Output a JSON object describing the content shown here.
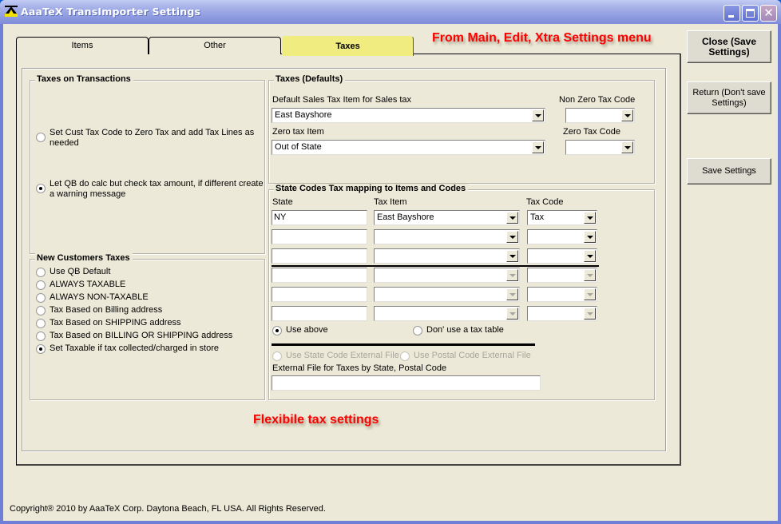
{
  "window": {
    "title": "AaaTeX TransImporter Settings",
    "controls": {
      "minimize": "_",
      "maximize": "□",
      "close": "✕"
    }
  },
  "tabs": [
    {
      "label": "Items",
      "active": false
    },
    {
      "label": "Other",
      "active": false
    },
    {
      "label": "Taxes",
      "active": true
    }
  ],
  "annotations": {
    "top": "From Main, Edit, Xtra Settings menu",
    "middle": "Flexibile tax settings"
  },
  "buttons": {
    "close_save": "Close (Save Settings)",
    "return_no_save": "Return (Don't save Settings)",
    "save_settings": "Save Settings"
  },
  "taxes_on_transactions": {
    "title": "Taxes on Transactions",
    "options": [
      {
        "label": "Set Cust Tax Code to Zero Tax and add Tax Lines as needed",
        "checked": false
      },
      {
        "label": "Let QB do calc but check tax amount, if different create a warning message",
        "checked": true
      }
    ]
  },
  "new_customers_taxes": {
    "title": "New Customers Taxes",
    "options": [
      {
        "label": "Use QB Default",
        "checked": false
      },
      {
        "label": "ALWAYS TAXABLE",
        "checked": false
      },
      {
        "label": "ALWAYS NON-TAXABLE",
        "checked": false
      },
      {
        "label": "Tax Based on Billing address",
        "checked": false
      },
      {
        "label": "Tax Based on SHIPPING address",
        "checked": false
      },
      {
        "label": "Tax Based on BILLING OR SHIPPING address",
        "checked": false
      },
      {
        "label": "Set Taxable if tax collected/charged in store",
        "checked": true
      }
    ]
  },
  "taxes_defaults": {
    "title": "Taxes (Defaults)",
    "default_sales_tax_item_label": "Default Sales Tax Item for Sales tax",
    "default_sales_tax_item_value": "East Bayshore",
    "non_zero_tax_code_label": "Non Zero Tax Code",
    "non_zero_tax_code_value": "",
    "zero_tax_item_label": "Zero tax Item",
    "zero_tax_item_value": "Out of State",
    "zero_tax_code_label": "Zero Tax Code",
    "zero_tax_code_value": ""
  },
  "state_codes": {
    "title": "State Codes Tax mapping to Items and Codes",
    "columns": [
      "State",
      "Tax Item",
      "Tax Code"
    ],
    "rows": [
      {
        "state": "NY",
        "tax_item": "East Bayshore",
        "tax_code": "Tax",
        "enabled": true
      },
      {
        "state": "",
        "tax_item": "",
        "tax_code": "",
        "enabled": true
      },
      {
        "state": "",
        "tax_item": "",
        "tax_code": "",
        "enabled": true
      },
      {
        "state": "",
        "tax_item": "",
        "tax_code": "",
        "enabled": false
      },
      {
        "state": "",
        "tax_item": "",
        "tax_code": "",
        "enabled": false
      },
      {
        "state": "",
        "tax_item": "",
        "tax_code": "",
        "enabled": false
      }
    ],
    "mode_options": [
      {
        "label": "Use above",
        "checked": true
      },
      {
        "label": "Don' use a tax table",
        "checked": false
      }
    ],
    "external_options": [
      {
        "label": "Use State Code External File",
        "checked": false,
        "disabled": true
      },
      {
        "label": "Use Postal Code External File",
        "checked": false,
        "disabled": true
      }
    ],
    "external_file_label": "External File for Taxes by State, Postal Code",
    "external_file_value": ""
  },
  "footer": {
    "copyright": "Copyright® 2010 by AaaTeX Corp. Daytona Beach, FL USA. All Rights Reserved."
  }
}
